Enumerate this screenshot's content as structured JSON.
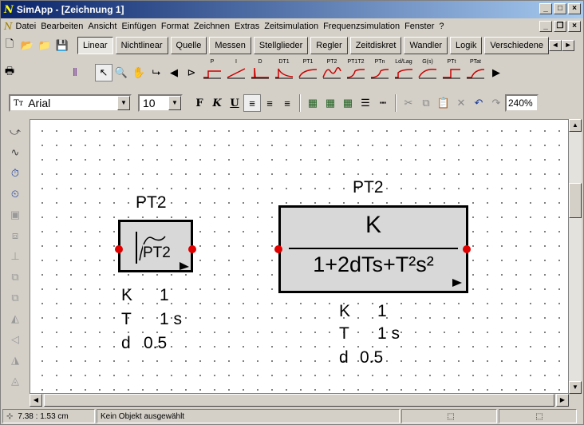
{
  "window": {
    "title": "SimApp - [Zeichnung 1]",
    "logo": "N"
  },
  "menu": {
    "items": [
      "Datei",
      "Bearbeiten",
      "Ansicht",
      "Einfügen",
      "Format",
      "Zeichnen",
      "Extras",
      "Zeitsimulation",
      "Frequenzsimulation",
      "Fenster",
      "?"
    ]
  },
  "tabs": {
    "items": [
      "Linear",
      "Nichtlinear",
      "Quelle",
      "Messen",
      "Stellglieder",
      "Regler",
      "Zeitdiskret",
      "Wandler",
      "Logik",
      "Verschiedene"
    ],
    "active": "Linear"
  },
  "blocks": {
    "items": [
      "P",
      "I",
      "D",
      "DT1",
      "PT1",
      "PT2",
      "PT1T2",
      "PTn",
      "Ld/Lag",
      "G(s)",
      "PTt",
      "PTat"
    ]
  },
  "format": {
    "font": "Arial",
    "size": "10",
    "bold": "F",
    "italic": "K",
    "underline": "U",
    "zoom": "240%"
  },
  "canvas": {
    "small_block": {
      "title": "PT2",
      "icon_text": "PT2",
      "params": [
        {
          "name": "K",
          "value": "1"
        },
        {
          "name": "T",
          "value": "1 s"
        },
        {
          "name": "d",
          "value": "0.5"
        }
      ]
    },
    "big_block": {
      "title": "PT2",
      "numerator": "K",
      "denominator": "1+2dTs+T²s²",
      "params": [
        {
          "name": "K",
          "value": "1"
        },
        {
          "name": "T",
          "value": "1 s"
        },
        {
          "name": "d",
          "value": "0.5"
        }
      ]
    }
  },
  "status": {
    "coords": "7.38 :  1.53 cm",
    "message": "Kein Objekt ausgewählt"
  }
}
